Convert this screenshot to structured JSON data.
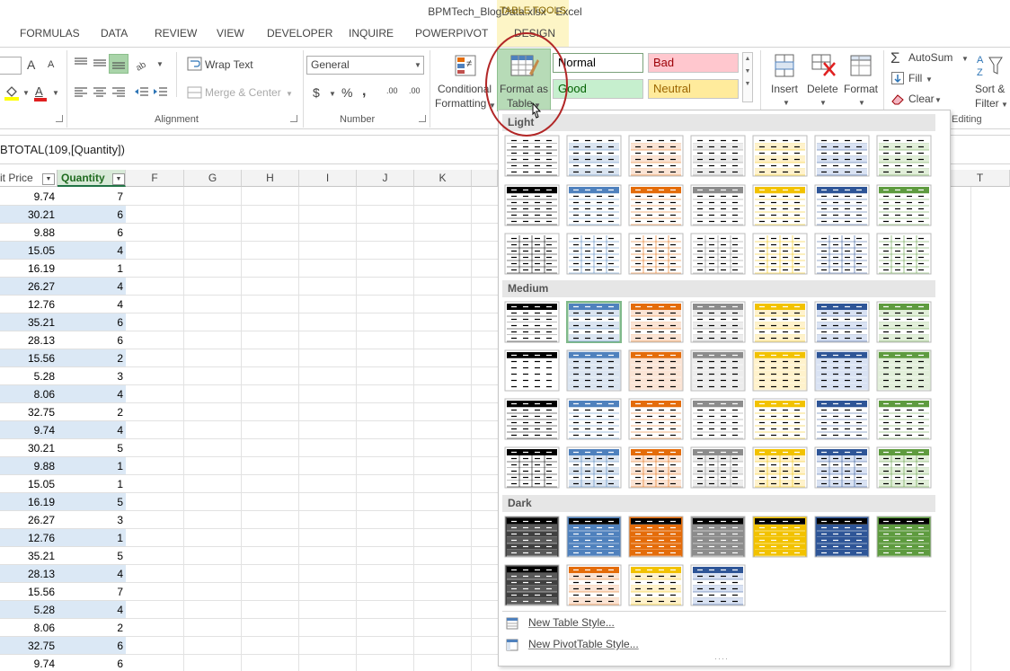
{
  "window": {
    "title": "BPMTech_BlogData.xlsx - Excel",
    "context_tab_group": "TABLE TOOLS"
  },
  "tabs": [
    "FORMULAS",
    "DATA",
    "REVIEW",
    "VIEW",
    "DEVELOPER",
    "INQUIRE",
    "POWERPIVOT",
    "DESIGN"
  ],
  "ribbon": {
    "font_grow": "A",
    "font_shrink": "A",
    "wrap_text": "Wrap Text",
    "merge_center": "Merge & Center",
    "number_format": "General",
    "currency": "$",
    "percent": "%",
    "comma": ",",
    "inc_dec": ".00",
    "dec_dec": ".00",
    "conditional_formatting": [
      "Conditional",
      "Formatting"
    ],
    "format_as_table": [
      "Format as",
      "Table"
    ],
    "cell_styles": {
      "normal": "Normal",
      "bad": "Bad",
      "good": "Good",
      "neutral": "Neutral"
    },
    "insert": "Insert",
    "delete": "Delete",
    "format": "Format",
    "autosum": "AutoSum",
    "fill": "Fill",
    "clear": "Clear",
    "sort_filter": [
      "Sort &",
      "Filter"
    ],
    "groups": {
      "alignment": "Alignment",
      "number": "Number",
      "editing": "Editing"
    },
    "colors": {
      "fill_yellow": "#ffff00",
      "font_red": "#e02020",
      "highlight_green": "#a9d4a9"
    }
  },
  "formula": "BTOTAL(109,[Quantity])",
  "columns": {
    "unit_price": "it Price",
    "quantity": "Quantity",
    "letters": [
      "F",
      "G",
      "H",
      "I",
      "J",
      "K"
    ],
    "far": "T"
  },
  "rows": [
    [
      "9.74",
      "7"
    ],
    [
      "30.21",
      "6"
    ],
    [
      "9.88",
      "6"
    ],
    [
      "15.05",
      "4"
    ],
    [
      "16.19",
      "1"
    ],
    [
      "26.27",
      "4"
    ],
    [
      "12.76",
      "4"
    ],
    [
      "35.21",
      "6"
    ],
    [
      "28.13",
      "6"
    ],
    [
      "15.56",
      "2"
    ],
    [
      "5.28",
      "3"
    ],
    [
      "8.06",
      "4"
    ],
    [
      "32.75",
      "2"
    ],
    [
      "9.74",
      "4"
    ],
    [
      "30.21",
      "5"
    ],
    [
      "9.88",
      "1"
    ],
    [
      "15.05",
      "1"
    ],
    [
      "16.19",
      "5"
    ],
    [
      "26.27",
      "3"
    ],
    [
      "12.76",
      "1"
    ],
    [
      "35.21",
      "5"
    ],
    [
      "28.13",
      "4"
    ],
    [
      "15.56",
      "7"
    ],
    [
      "5.28",
      "4"
    ],
    [
      "8.06",
      "2"
    ],
    [
      "32.75",
      "6"
    ],
    [
      "9.74",
      "6"
    ]
  ],
  "gallery": {
    "sections": {
      "light": "Light",
      "medium": "Medium",
      "dark": "Dark"
    },
    "palette": [
      "#000000",
      "#4f81bd",
      "#e46c0a",
      "#8c8c8c",
      "#f2c200",
      "#2e5597",
      "#5e9b3f"
    ],
    "palette_light": [
      "#ffffff",
      "#dbe5f1",
      "#fbe4d5",
      "#ededed",
      "#fff2cc",
      "#d9e2f3",
      "#e2efda"
    ],
    "new_table_style": "New Table Style...",
    "new_pivot_style": "New PivotTable Style..."
  }
}
